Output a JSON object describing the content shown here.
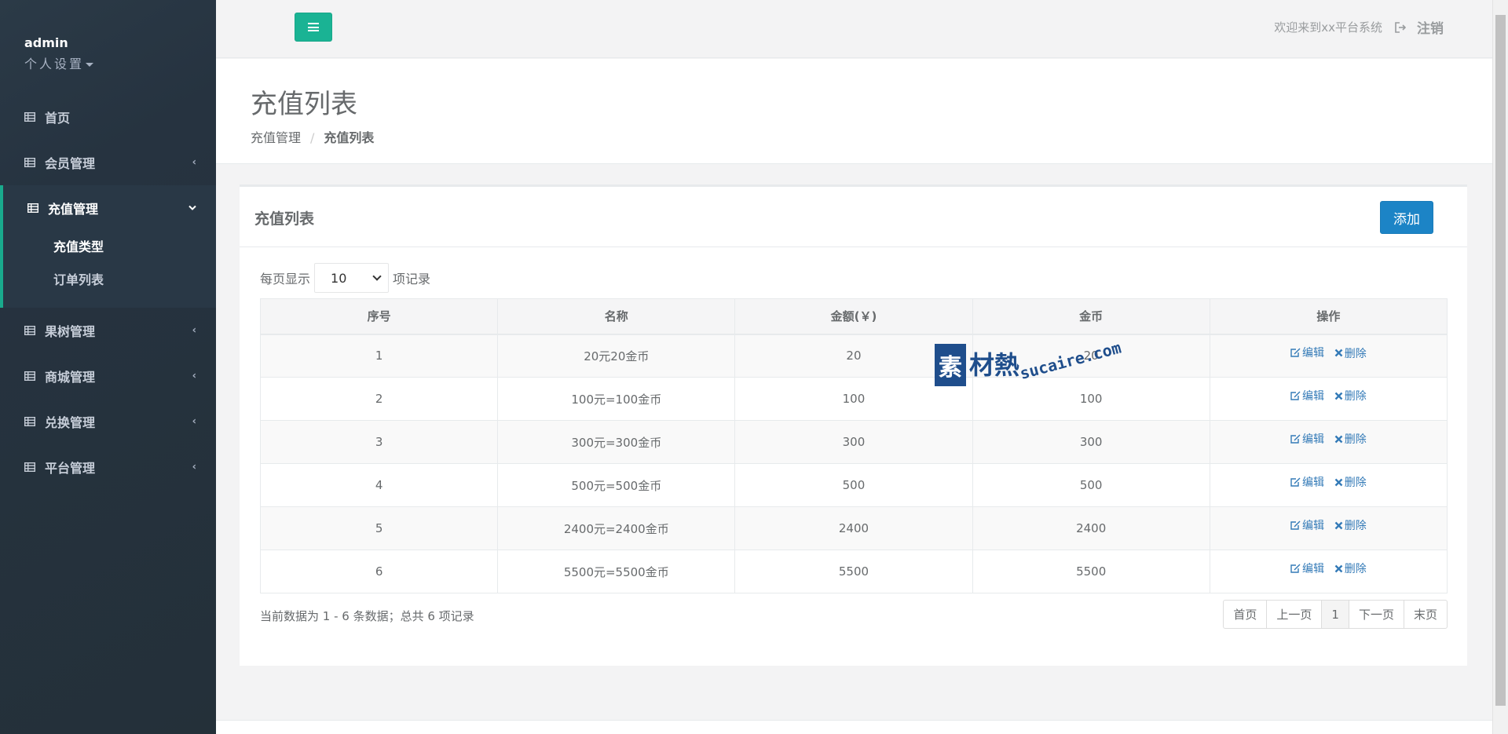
{
  "sidebar": {
    "username": "admin",
    "settings_label": "个人设置",
    "items": [
      {
        "label": "首页"
      },
      {
        "label": "会员管理"
      },
      {
        "label": "充值管理",
        "subitems": [
          {
            "label": "充值类型"
          },
          {
            "label": "订单列表"
          }
        ]
      },
      {
        "label": "果树管理"
      },
      {
        "label": "商城管理"
      },
      {
        "label": "兑换管理"
      },
      {
        "label": "平台管理"
      }
    ]
  },
  "topbar": {
    "welcome": "欢迎来到xx平台系统",
    "logout": "注销"
  },
  "header": {
    "title": "充值列表",
    "breadcrumb": [
      "充值管理",
      "充值列表"
    ]
  },
  "panel": {
    "title": "充值列表",
    "add_label": "添加",
    "length_prefix": "每页显示",
    "length_value": "10",
    "length_suffix": "项记录",
    "columns": [
      "序号",
      "名称",
      "金额(￥)",
      "金币",
      "操作"
    ],
    "rows": [
      {
        "no": "1",
        "name": "20元20金币",
        "amount": "20",
        "coins": "20"
      },
      {
        "no": "2",
        "name": "100元=100金币",
        "amount": "100",
        "coins": "100"
      },
      {
        "no": "3",
        "name": "300元=300金币",
        "amount": "300",
        "coins": "300"
      },
      {
        "no": "4",
        "name": "500元=500金币",
        "amount": "500",
        "coins": "500"
      },
      {
        "no": "5",
        "name": "2400元=2400金币",
        "amount": "2400",
        "coins": "2400"
      },
      {
        "no": "6",
        "name": "5500元=5500金币",
        "amount": "5500",
        "coins": "5500"
      }
    ],
    "edit_label": "编辑",
    "delete_label": "删除",
    "info": "当前数据为 1 - 6 条数据；总共 6 项记录",
    "pager": {
      "first": "首页",
      "prev": "上一页",
      "current": "1",
      "next": "下一页",
      "last": "末页"
    }
  },
  "watermark": {
    "cn_box": "素",
    "cn": "材熱",
    "en": "sucaire.com"
  },
  "colors": {
    "sidebar": "#2f4050",
    "accent": "#1ab394",
    "primary": "#1c84c6",
    "link": "#337ab7"
  },
  "icons": {
    "nav": "grid-icon",
    "menu": "bars-icon",
    "logout": "sign-out-icon",
    "edit": "edit-icon",
    "delete": "times-icon"
  }
}
